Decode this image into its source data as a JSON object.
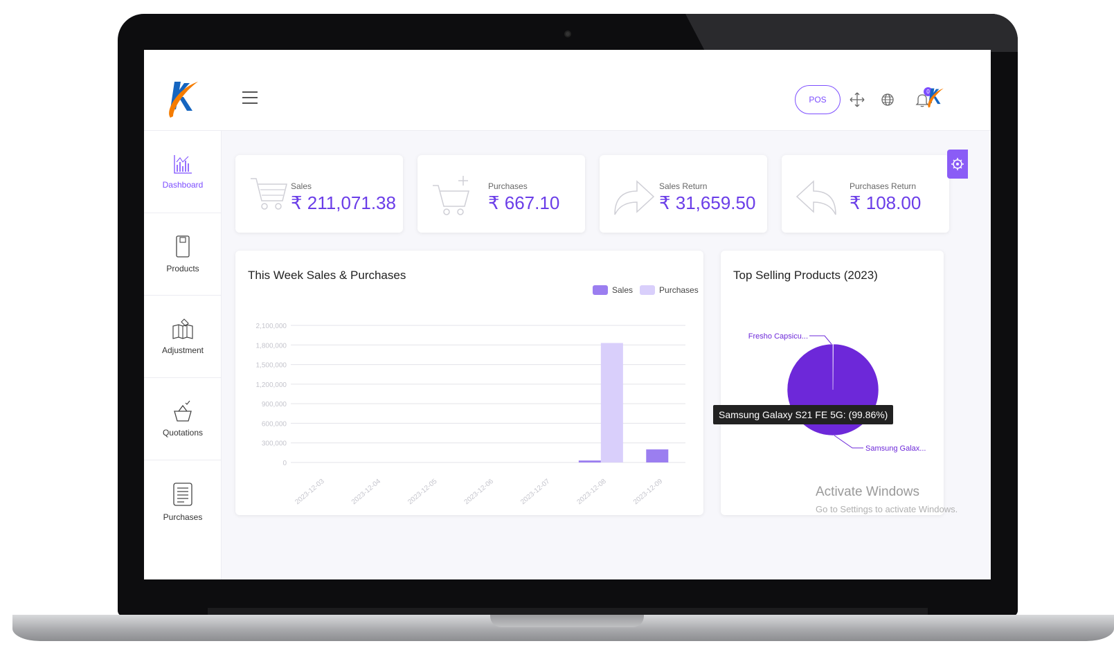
{
  "topbar": {
    "pos_label": "POS",
    "notification_count": "0"
  },
  "sidebar": {
    "items": [
      {
        "label": "Dashboard",
        "icon": "chart-icon",
        "active": true
      },
      {
        "label": "Products",
        "icon": "product-icon"
      },
      {
        "label": "Adjustment",
        "icon": "adjustment-icon"
      },
      {
        "label": "Quotations",
        "icon": "basket-icon"
      },
      {
        "label": "Purchases",
        "icon": "receipt-icon"
      }
    ]
  },
  "stats": [
    {
      "label": "Sales",
      "value": "₹ 211,071.38",
      "icon": "cart-icon"
    },
    {
      "label": "Purchases",
      "value": "₹ 667.10",
      "icon": "cart-plus-icon"
    },
    {
      "label": "Sales Return",
      "value": "₹ 31,659.50",
      "icon": "forward-arrow-icon"
    },
    {
      "label": "Purchases Return",
      "value": "₹ 108.00",
      "icon": "back-arrow-icon"
    }
  ],
  "colors": {
    "accent": "#7c4dff",
    "sales": "#9b7ef0",
    "purchases": "#d9cffb",
    "pie": "#6d28d9"
  },
  "weekly_chart": {
    "title": "This Week Sales & Purchases",
    "legend": [
      "Sales",
      "Purchases"
    ]
  },
  "top_products": {
    "title": "Top Selling Products (2023)",
    "labels": [
      "Fresho Capsicu...",
      "Samsung Galax..."
    ],
    "tooltip": "Samsung Galaxy S21 FE 5G: (99.86%)"
  },
  "watermark": {
    "title": "Activate Windows",
    "subtitle": "Go to Settings to activate Windows."
  },
  "chart_data": [
    {
      "type": "bar",
      "title": "This Week Sales & Purchases",
      "categories": [
        "2023-12-03",
        "2023-12-04",
        "2023-12-05",
        "2023-12-06",
        "2023-12-07",
        "2023-12-08",
        "2023-12-09"
      ],
      "y_ticks": [
        "2,100,000",
        "1,800,000",
        "1,500,000",
        "1,200,000",
        "900,000",
        "600,000",
        "300,000",
        "0"
      ],
      "ylim": [
        0,
        2100000
      ],
      "series": [
        {
          "name": "Sales",
          "values": [
            0,
            0,
            0,
            0,
            0,
            30000,
            200000
          ]
        },
        {
          "name": "Purchases",
          "values": [
            0,
            0,
            0,
            0,
            0,
            1830000,
            0
          ]
        }
      ],
      "legend": "top-right"
    },
    {
      "type": "pie",
      "title": "Top Selling Products (2023)",
      "labels": [
        "Fresho Capsicu...",
        "Samsung Galax..."
      ],
      "values": [
        0.14,
        99.86
      ]
    }
  ]
}
